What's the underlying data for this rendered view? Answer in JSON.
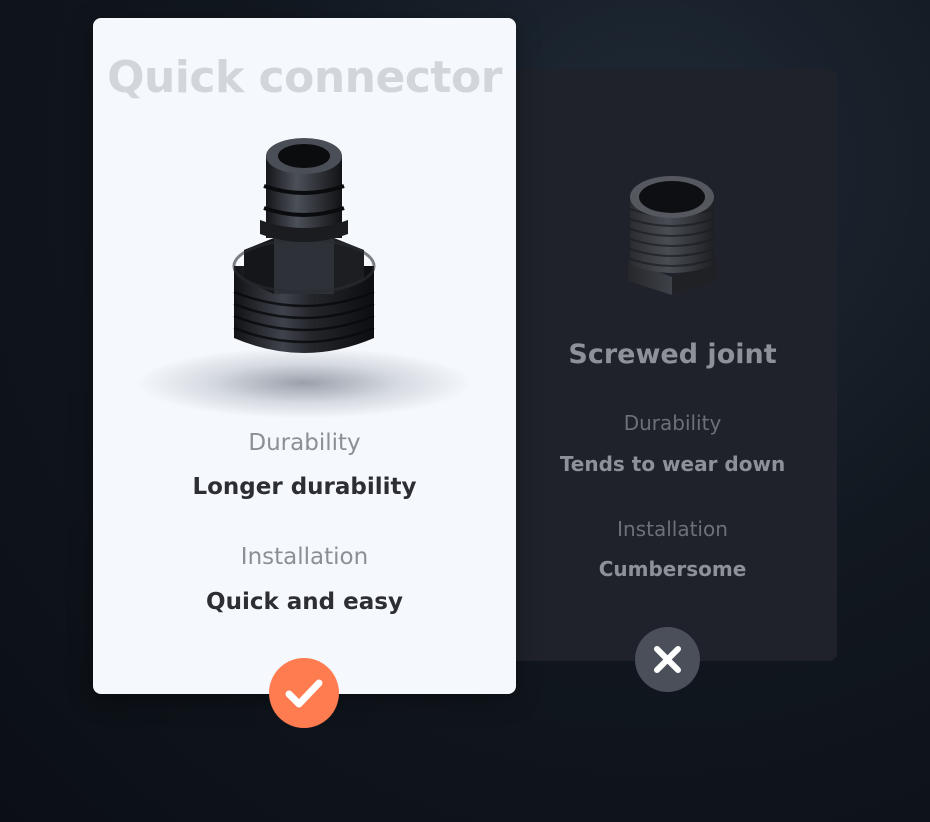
{
  "quick_connector": {
    "title": "Quick connector",
    "durability_label": "Durability",
    "durability_value": "Longer durability",
    "installation_label": "Installation",
    "installation_value": "Quick and easy",
    "status_icon": "check-icon",
    "status_color": "#ff7b50"
  },
  "screwed_joint": {
    "title": "Screwed joint",
    "durability_label": "Durability",
    "durability_value": "Tends to wear down",
    "installation_label": "Installation",
    "installation_value": "Cumbersome",
    "status_icon": "close-icon",
    "status_color": "#4b4f59"
  }
}
